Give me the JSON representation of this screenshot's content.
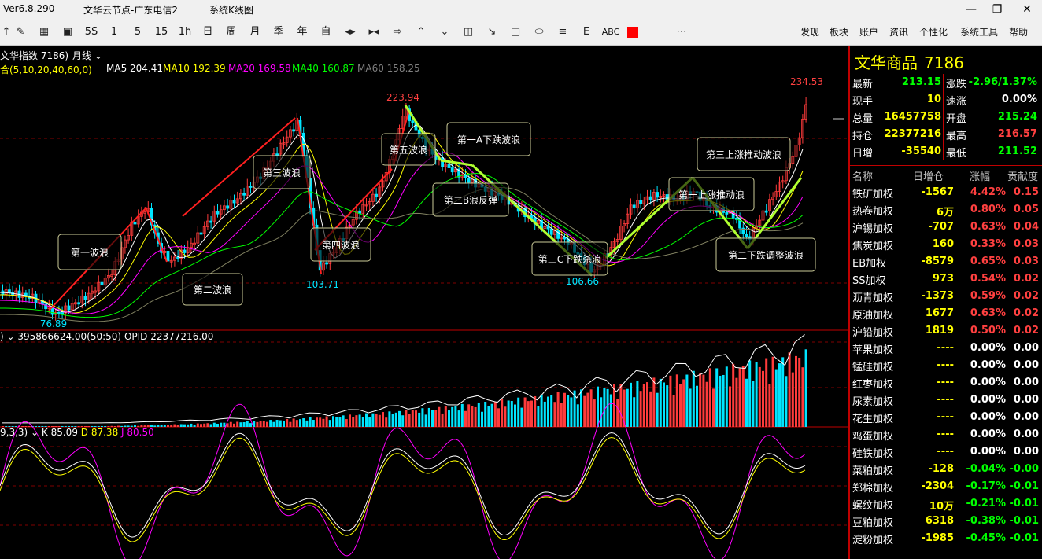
{
  "window": {
    "version": "Ver6.8.290",
    "server": "文华云节点-广东电信2",
    "view": "系统K线图"
  },
  "toolbar": {
    "periods": [
      "5S",
      "1",
      "5",
      "15",
      "1h",
      "日",
      "周",
      "月",
      "季",
      "年",
      "自"
    ],
    "text_tools": [
      "ABC"
    ],
    "menu": [
      "发现",
      "板块",
      "账户",
      "资讯",
      "个性化",
      "系统工具",
      "帮助"
    ]
  },
  "chart": {
    "symbol_label": "文华指数 7186)",
    "period_label": "月线",
    "ma_label": "合(5,10,20,40,60,0)",
    "ma_values": [
      {
        "name": "MA5",
        "value": "204.41",
        "color": "#ffffff"
      },
      {
        "name": "MA10",
        "value": "192.39",
        "color": "#ffff00"
      },
      {
        "name": "MA20",
        "value": "169.58",
        "color": "#ff00ff"
      },
      {
        "name": "MA40",
        "value": "160.87",
        "color": "#00ff00"
      },
      {
        "name": "MA60",
        "value": "158.25",
        "color": "#808080"
      }
    ],
    "price_labels": {
      "high_all": "234.53",
      "peak5": "223.94",
      "low1": "76.89",
      "low2": "103.71",
      "low3": "106.66"
    },
    "wave_labels": [
      "第一波浪",
      "第二波浪",
      "第三波浪",
      "第四波浪",
      "第五波浪",
      "第一A下跌波浪",
      "第二B浪反弹",
      "第三C下跌杀浪",
      "第一上涨推动浪",
      "第二下跌调整波浪",
      "第三上涨推动波浪"
    ],
    "volume_header": {
      "left": ")",
      "value": "395866624.00(50:50)",
      "opid_label": "OPID",
      "opid": "22377216.00"
    },
    "kdj_header": {
      "params": "9,3,3)",
      "K": "85.09",
      "D": "87.38",
      "J": "80.50"
    }
  },
  "panel": {
    "name": "文华商品",
    "code": "7186",
    "quote": [
      {
        "l": "最新",
        "v": "213.15",
        "vc": "#00ff00",
        "l2": "涨跌",
        "v2": "-2.96/1.37%",
        "v2c": "#00ff00"
      },
      {
        "l": "现手",
        "v": "10",
        "vc": "#ffff00",
        "l2": "速涨",
        "v2": "0.00%",
        "v2c": "#ffffff"
      },
      {
        "l": "总量",
        "v": "16457758",
        "vc": "#ffff00",
        "l2": "开盘",
        "v2": "215.24",
        "v2c": "#00ff00"
      },
      {
        "l": "持仓",
        "v": "22377216",
        "vc": "#ffff00",
        "l2": "最高",
        "v2": "216.57",
        "v2c": "#ff4040"
      },
      {
        "l": "日增",
        "v": "-35540",
        "vc": "#ffff00",
        "l2": "最低",
        "v2": "211.52",
        "v2c": "#00ff00"
      }
    ],
    "table_headers": [
      "名称",
      "日增仓",
      "涨幅",
      "贡献度"
    ],
    "rows": [
      {
        "n": "铁矿加权",
        "a": "-1567",
        "b": "4.42%",
        "c": "0.15",
        "col": "#ff4040"
      },
      {
        "n": "热卷加权",
        "a": "6万",
        "b": "0.80%",
        "c": "0.05",
        "col": "#ff4040"
      },
      {
        "n": "沪锡加权",
        "a": "-707",
        "b": "0.63%",
        "c": "0.04",
        "col": "#ff4040"
      },
      {
        "n": "焦炭加权",
        "a": "160",
        "b": "0.33%",
        "c": "0.03",
        "col": "#ff4040"
      },
      {
        "n": "EB加权",
        "a": "-8579",
        "b": "0.65%",
        "c": "0.03",
        "col": "#ff4040"
      },
      {
        "n": "SS加权",
        "a": "973",
        "b": "0.54%",
        "c": "0.02",
        "col": "#ff4040"
      },
      {
        "n": "沥青加权",
        "a": "-1373",
        "b": "0.59%",
        "c": "0.02",
        "col": "#ff4040"
      },
      {
        "n": "原油加权",
        "a": "1677",
        "b": "0.63%",
        "c": "0.02",
        "col": "#ff4040"
      },
      {
        "n": "沪铅加权",
        "a": "1819",
        "b": "0.50%",
        "c": "0.02",
        "col": "#ff4040"
      },
      {
        "n": "苹果加权",
        "a": "----",
        "b": "0.00%",
        "c": "0.00",
        "col": "#ffffff"
      },
      {
        "n": "锰硅加权",
        "a": "----",
        "b": "0.00%",
        "c": "0.00",
        "col": "#ffffff"
      },
      {
        "n": "红枣加权",
        "a": "----",
        "b": "0.00%",
        "c": "0.00",
        "col": "#ffffff"
      },
      {
        "n": "尿素加权",
        "a": "----",
        "b": "0.00%",
        "c": "0.00",
        "col": "#ffffff"
      },
      {
        "n": "花生加权",
        "a": "----",
        "b": "0.00%",
        "c": "0.00",
        "col": "#ffffff"
      },
      {
        "n": "鸡蛋加权",
        "a": "----",
        "b": "0.00%",
        "c": "0.00",
        "col": "#ffffff"
      },
      {
        "n": "硅铁加权",
        "a": "----",
        "b": "0.00%",
        "c": "0.00",
        "col": "#ffffff"
      },
      {
        "n": "菜粕加权",
        "a": "-128",
        "b": "-0.04%",
        "c": "-0.00",
        "col": "#00ff00"
      },
      {
        "n": "郑棉加权",
        "a": "-2304",
        "b": "-0.17%",
        "c": "-0.01",
        "col": "#00ff00"
      },
      {
        "n": "螺纹加权",
        "a": "10万",
        "b": "-0.21%",
        "c": "-0.01",
        "col": "#00ff00"
      },
      {
        "n": "豆粕加权",
        "a": "6318",
        "b": "-0.38%",
        "c": "-0.01",
        "col": "#00ff00"
      },
      {
        "n": "淀粉加权",
        "a": "-1985",
        "b": "-0.45%",
        "c": "-0.01",
        "col": "#00ff00"
      }
    ]
  }
}
